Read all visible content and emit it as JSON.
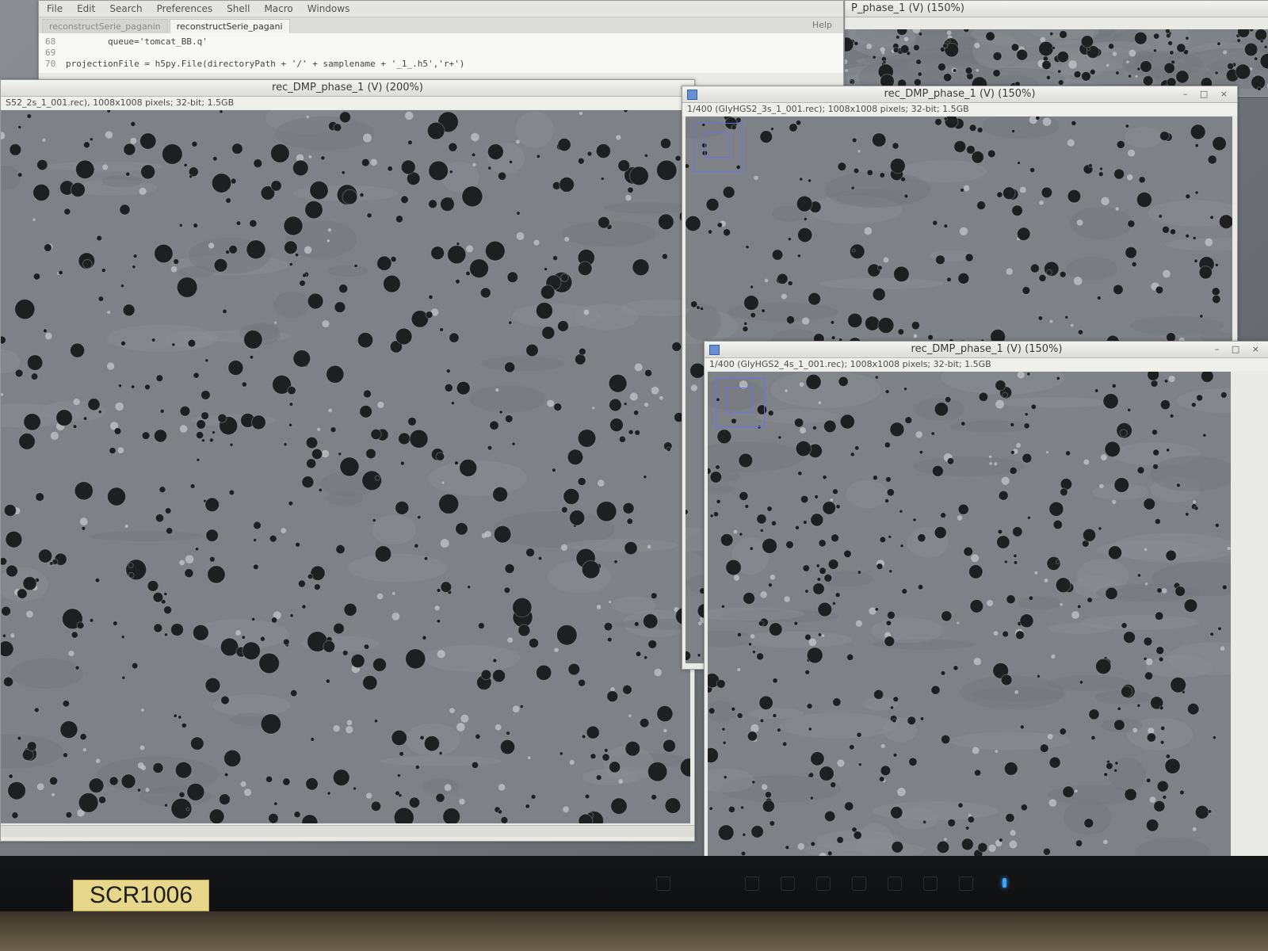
{
  "editor": {
    "menu": [
      "File",
      "Edit",
      "Search",
      "Preferences",
      "Shell",
      "Macro",
      "Windows"
    ],
    "tabs": [
      {
        "label": "reconstructSerie_paganin",
        "active": false
      },
      {
        "label": "reconstructSerie_pagani",
        "active": true
      }
    ],
    "help_label": "Help",
    "code_lines": [
      {
        "num": "68",
        "text": "        queue='tomcat_BB.q'"
      },
      {
        "num": "69",
        "text": ""
      },
      {
        "num": "70",
        "text": "projectionFile = h5py.File(directoryPath + '/' + samplename + '_1_.h5','r+')"
      }
    ]
  },
  "window_far_right": {
    "title": "P_phase_1 (V) (150%)"
  },
  "window_left": {
    "title": "rec_DMP_phase_1 (V) (200%)",
    "subtitle": "S52_2s_1_001.rec), 1008x1008 pixels; 32-bit; 1.5GB"
  },
  "window_right_top": {
    "title": "rec_DMP_phase_1 (V) (150%)",
    "subtitle": "1/400 (GlyHGS2_3s_1_001.rec); 1008x1008 pixels; 32-bit; 1.5GB"
  },
  "window_right_bottom": {
    "title": "rec_DMP_phase_1 (V) (150%)",
    "subtitle": "1/400 (GlyHGS2_4s_1_001.rec); 1008x1008 pixels; 32-bit; 1.5GB"
  },
  "monitor": {
    "asset_tag": "SCR1006"
  },
  "colors": {
    "roi": "#6b6ff0",
    "power_led": "#3fa3ff",
    "asset_tag_bg": "#e7d78a"
  }
}
